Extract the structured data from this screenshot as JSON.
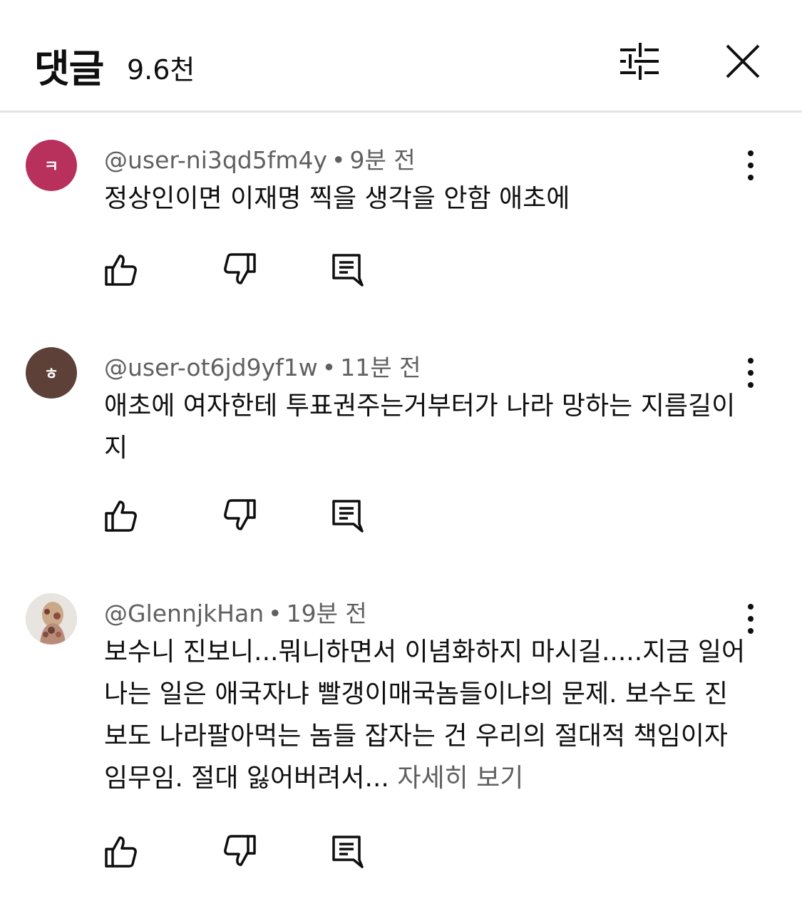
{
  "header": {
    "title": "댓글",
    "count": "9.6천",
    "filter_icon": "sliders-icon",
    "close_icon": "close-icon"
  },
  "comments": [
    {
      "avatar_letter": "ㅋ",
      "avatar_color": "#b8305c",
      "handle": "@user-ni3qd5fm4y",
      "time": "9분 전",
      "text": "정상인이면 이재명 찍을 생각을 안함 애초에",
      "see_more": ""
    },
    {
      "avatar_letter": "ㅎ",
      "avatar_color": "#5d4037",
      "handle": "@user-ot6jd9yf1w",
      "time": "11분 전",
      "text": "애초에 여자한테 투표권주는거부터가 나라 망하는 지름길이지",
      "see_more": ""
    },
    {
      "avatar_letter": "",
      "avatar_color": "#d8d2cc",
      "handle": "@GlennjkHan",
      "time": "19분 전",
      "text": "보수니 진보니...뭐니하면서 이념화하지 마시길.....지금 일어나는 일은 애국자냐 빨갱이매국놈들이냐의 문제. 보수도 진보도 나라팔아먹는 놈들 잡자는 건 우리의 절대적 책임이자 임무임. 절대 잃어버려서...",
      "see_more": " 자세히 보기"
    }
  ],
  "colors": {
    "text": "#0f0f0f",
    "secondary": "#606060",
    "divider": "#e5e5e5"
  }
}
